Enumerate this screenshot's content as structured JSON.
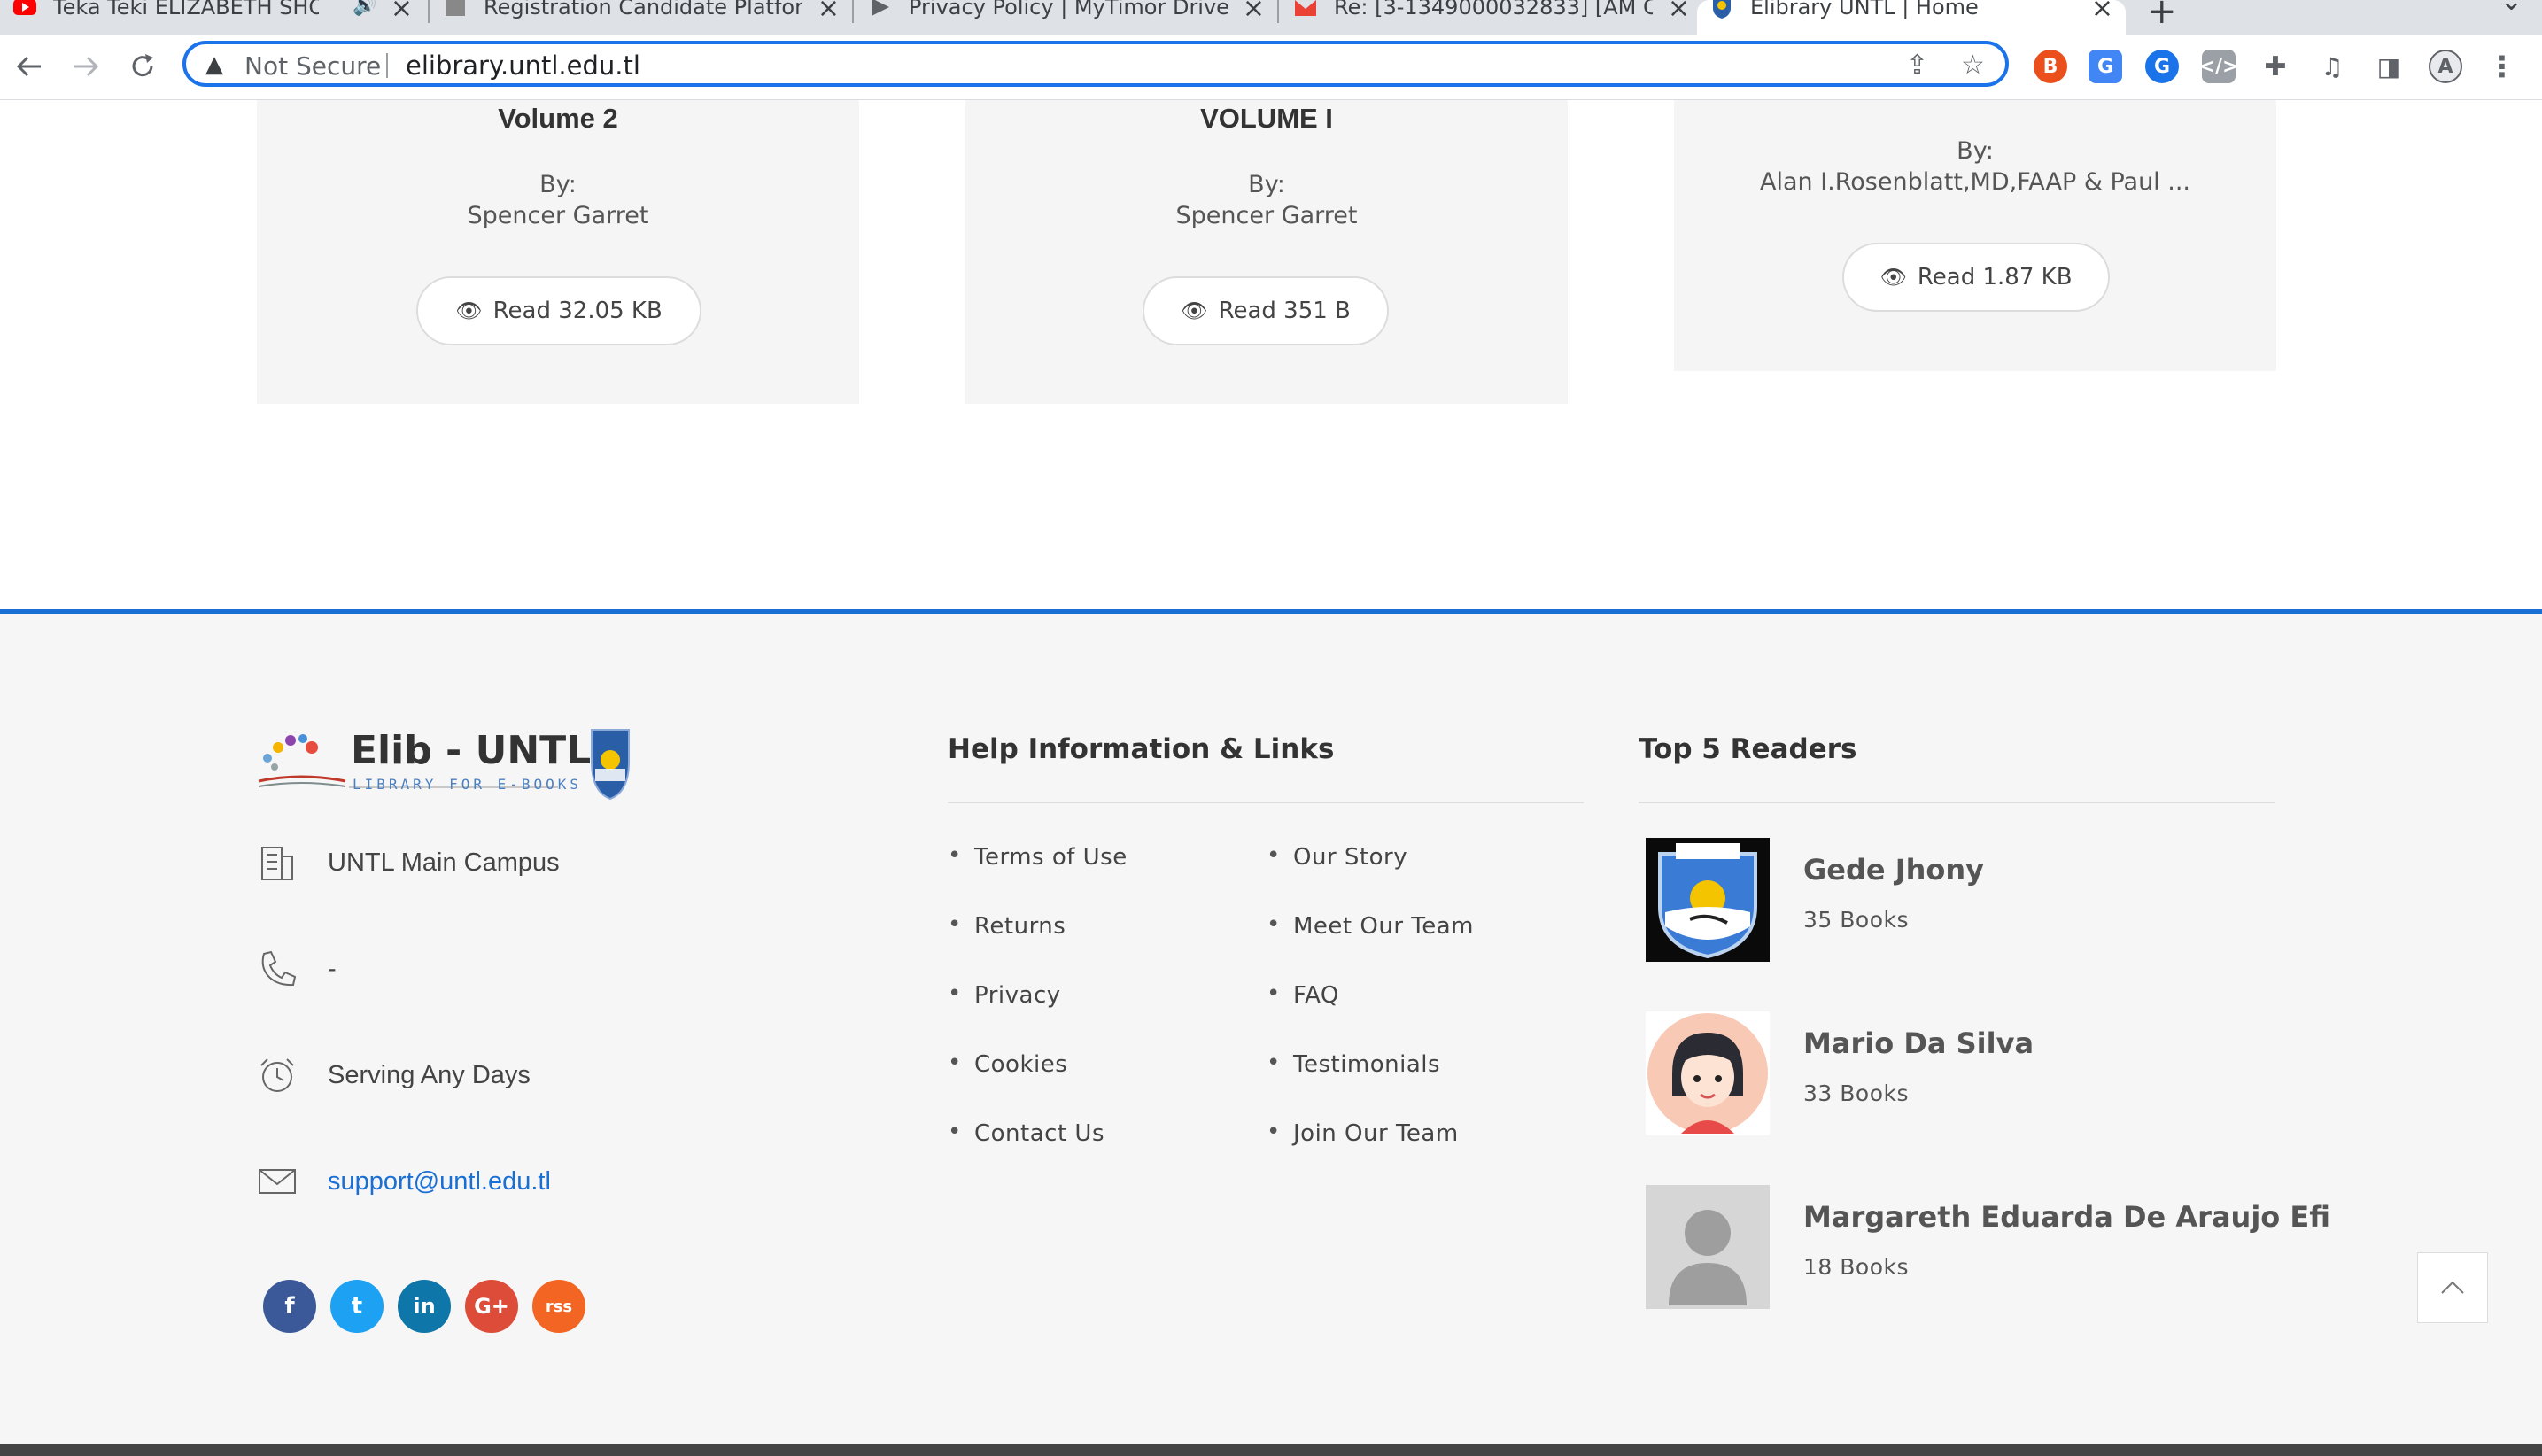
{
  "browser": {
    "tabs": [
      {
        "title": "Teka Teki ELIZABETH SHO"
      },
      {
        "title": "Registration Candidate Platform"
      },
      {
        "title": "Privacy Policy | MyTimor Driver"
      },
      {
        "title": "Re: [3-1349000032833] [AM C"
      },
      {
        "title": "Elibrary UNTL | Home"
      }
    ],
    "security_label": "Not Secure",
    "url": "elibrary.untl.edu.tl"
  },
  "books": [
    {
      "title": "Volume 2",
      "by": "By:",
      "author": "Spencer Garret",
      "read_label": "Read 32.05 KB"
    },
    {
      "title": "VOLUME I",
      "by": "By:",
      "author": "Spencer Garret",
      "read_label": "Read 351 B"
    },
    {
      "title": "",
      "by": "By:",
      "author": "Alan I.Rosenblatt,MD,FAAP & Paul ...",
      "read_label": "Read 1.87 KB"
    }
  ],
  "footer": {
    "logo": {
      "title": "Elib - UNTL",
      "subtitle": "LIBRARY FOR E-BOOKS"
    },
    "contact": {
      "address": "UNTL Main Campus",
      "phone": "-",
      "hours": "Serving Any Days",
      "email": "support@untl.edu.tl"
    },
    "social": [
      {
        "name": "facebook",
        "glyph": "f",
        "color": "#3b5998"
      },
      {
        "name": "twitter",
        "glyph": "t",
        "color": "#1da1f2"
      },
      {
        "name": "linkedin",
        "glyph": "in",
        "color": "#0e76a8"
      },
      {
        "name": "google-plus",
        "glyph": "G+",
        "color": "#dd4b39"
      },
      {
        "name": "rss",
        "glyph": "rss",
        "color": "#f26522"
      }
    ],
    "help": {
      "title": "Help Information & Links",
      "left": [
        "Terms of Use",
        "Returns",
        "Privacy",
        "Cookies",
        "Contact Us"
      ],
      "right": [
        "Our Story",
        "Meet Our Team",
        "FAQ",
        "Testimonials",
        "Join Our Team"
      ]
    },
    "readers": {
      "title": "Top 5 Readers",
      "list": [
        {
          "name": "Gede Jhony",
          "books": "35 Books"
        },
        {
          "name": "Mario Da Silva",
          "books": "33 Books"
        },
        {
          "name": "Margareth Eduarda De Araujo Efi",
          "books": "18 Books"
        }
      ]
    }
  }
}
